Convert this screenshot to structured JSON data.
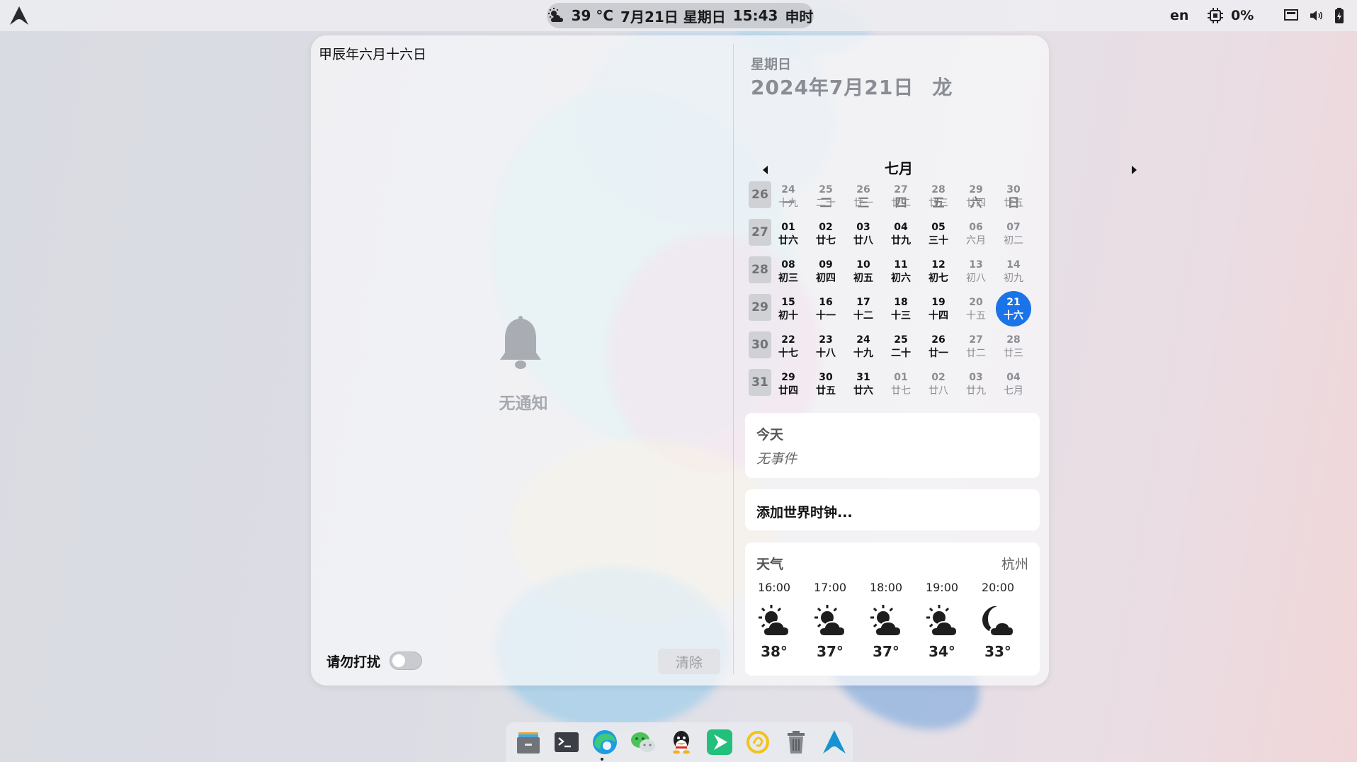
{
  "topbar": {
    "clock": {
      "temp": "39 °C",
      "date": "7月21日 星期日",
      "time": "15:43",
      "shichen": "申时"
    },
    "lang": "en",
    "cpu": "0%"
  },
  "notify": {
    "lunar_title": "甲辰年六月十六日",
    "empty_text": "无通知",
    "dnd_label": "请勿打扰",
    "clear_label": "清除"
  },
  "calendar": {
    "weekday": "星期日",
    "date": "2024年7月21日",
    "zodiac": "龙",
    "month": "七月",
    "week_headers": [
      "一",
      "二",
      "三",
      "四",
      "五",
      "六",
      "日"
    ],
    "week_numbers": [
      "26",
      "27",
      "28",
      "29",
      "30",
      "31"
    ],
    "days": [
      [
        [
          "24",
          "十九",
          0
        ],
        [
          "25",
          "二十",
          0
        ],
        [
          "26",
          "廿一",
          0
        ],
        [
          "27",
          "廿二",
          0
        ],
        [
          "28",
          "廿三",
          0
        ],
        [
          "29",
          "廿四",
          0
        ],
        [
          "30",
          "廿五",
          0
        ]
      ],
      [
        [
          "01",
          "廿六",
          1
        ],
        [
          "02",
          "廿七",
          1
        ],
        [
          "03",
          "廿八",
          1
        ],
        [
          "04",
          "廿九",
          1
        ],
        [
          "05",
          "三十",
          1
        ],
        [
          "06",
          "六月",
          0
        ],
        [
          "07",
          "初二",
          0
        ]
      ],
      [
        [
          "08",
          "初三",
          1
        ],
        [
          "09",
          "初四",
          1
        ],
        [
          "10",
          "初五",
          1
        ],
        [
          "11",
          "初六",
          1
        ],
        [
          "12",
          "初七",
          1
        ],
        [
          "13",
          "初八",
          0
        ],
        [
          "14",
          "初九",
          0
        ]
      ],
      [
        [
          "15",
          "初十",
          1
        ],
        [
          "16",
          "十一",
          1
        ],
        [
          "17",
          "十二",
          1
        ],
        [
          "18",
          "十三",
          1
        ],
        [
          "19",
          "十四",
          1
        ],
        [
          "20",
          "十五",
          0
        ],
        [
          "21",
          "十六",
          2
        ]
      ],
      [
        [
          "22",
          "十七",
          1
        ],
        [
          "23",
          "十八",
          1
        ],
        [
          "24",
          "十九",
          1
        ],
        [
          "25",
          "二十",
          1
        ],
        [
          "26",
          "廿一",
          1
        ],
        [
          "27",
          "廿二",
          0
        ],
        [
          "28",
          "廿三",
          0
        ]
      ],
      [
        [
          "29",
          "廿四",
          1
        ],
        [
          "30",
          "廿五",
          1
        ],
        [
          "31",
          "廿六",
          1
        ],
        [
          "01",
          "廿七",
          0
        ],
        [
          "02",
          "廿八",
          0
        ],
        [
          "03",
          "廿九",
          0
        ],
        [
          "04",
          "七月",
          0
        ]
      ]
    ]
  },
  "events": {
    "title": "今天",
    "empty": "无事件"
  },
  "world_clock": {
    "label": "添加世界时钟..."
  },
  "weather": {
    "title": "天气",
    "city": "杭州",
    "hours": [
      {
        "time": "16:00",
        "temp": "38°",
        "icon": "partly-cloudy-day-icon"
      },
      {
        "time": "17:00",
        "temp": "37°",
        "icon": "partly-cloudy-day-icon"
      },
      {
        "time": "18:00",
        "temp": "37°",
        "icon": "partly-cloudy-day-icon"
      },
      {
        "time": "19:00",
        "temp": "34°",
        "icon": "partly-cloudy-day-icon"
      },
      {
        "time": "20:00",
        "temp": "33°",
        "icon": "cloudy-night-icon"
      }
    ]
  },
  "dock": [
    "file-manager-icon",
    "terminal-icon",
    "edge-browser-icon",
    "wechat-icon",
    "qq-icon",
    "media-player-icon",
    "notes-app-icon",
    "trash-icon",
    "arch-launcher-icon"
  ],
  "colors": {
    "accent": "#1a73e8",
    "panel": "#f8f8fa"
  }
}
